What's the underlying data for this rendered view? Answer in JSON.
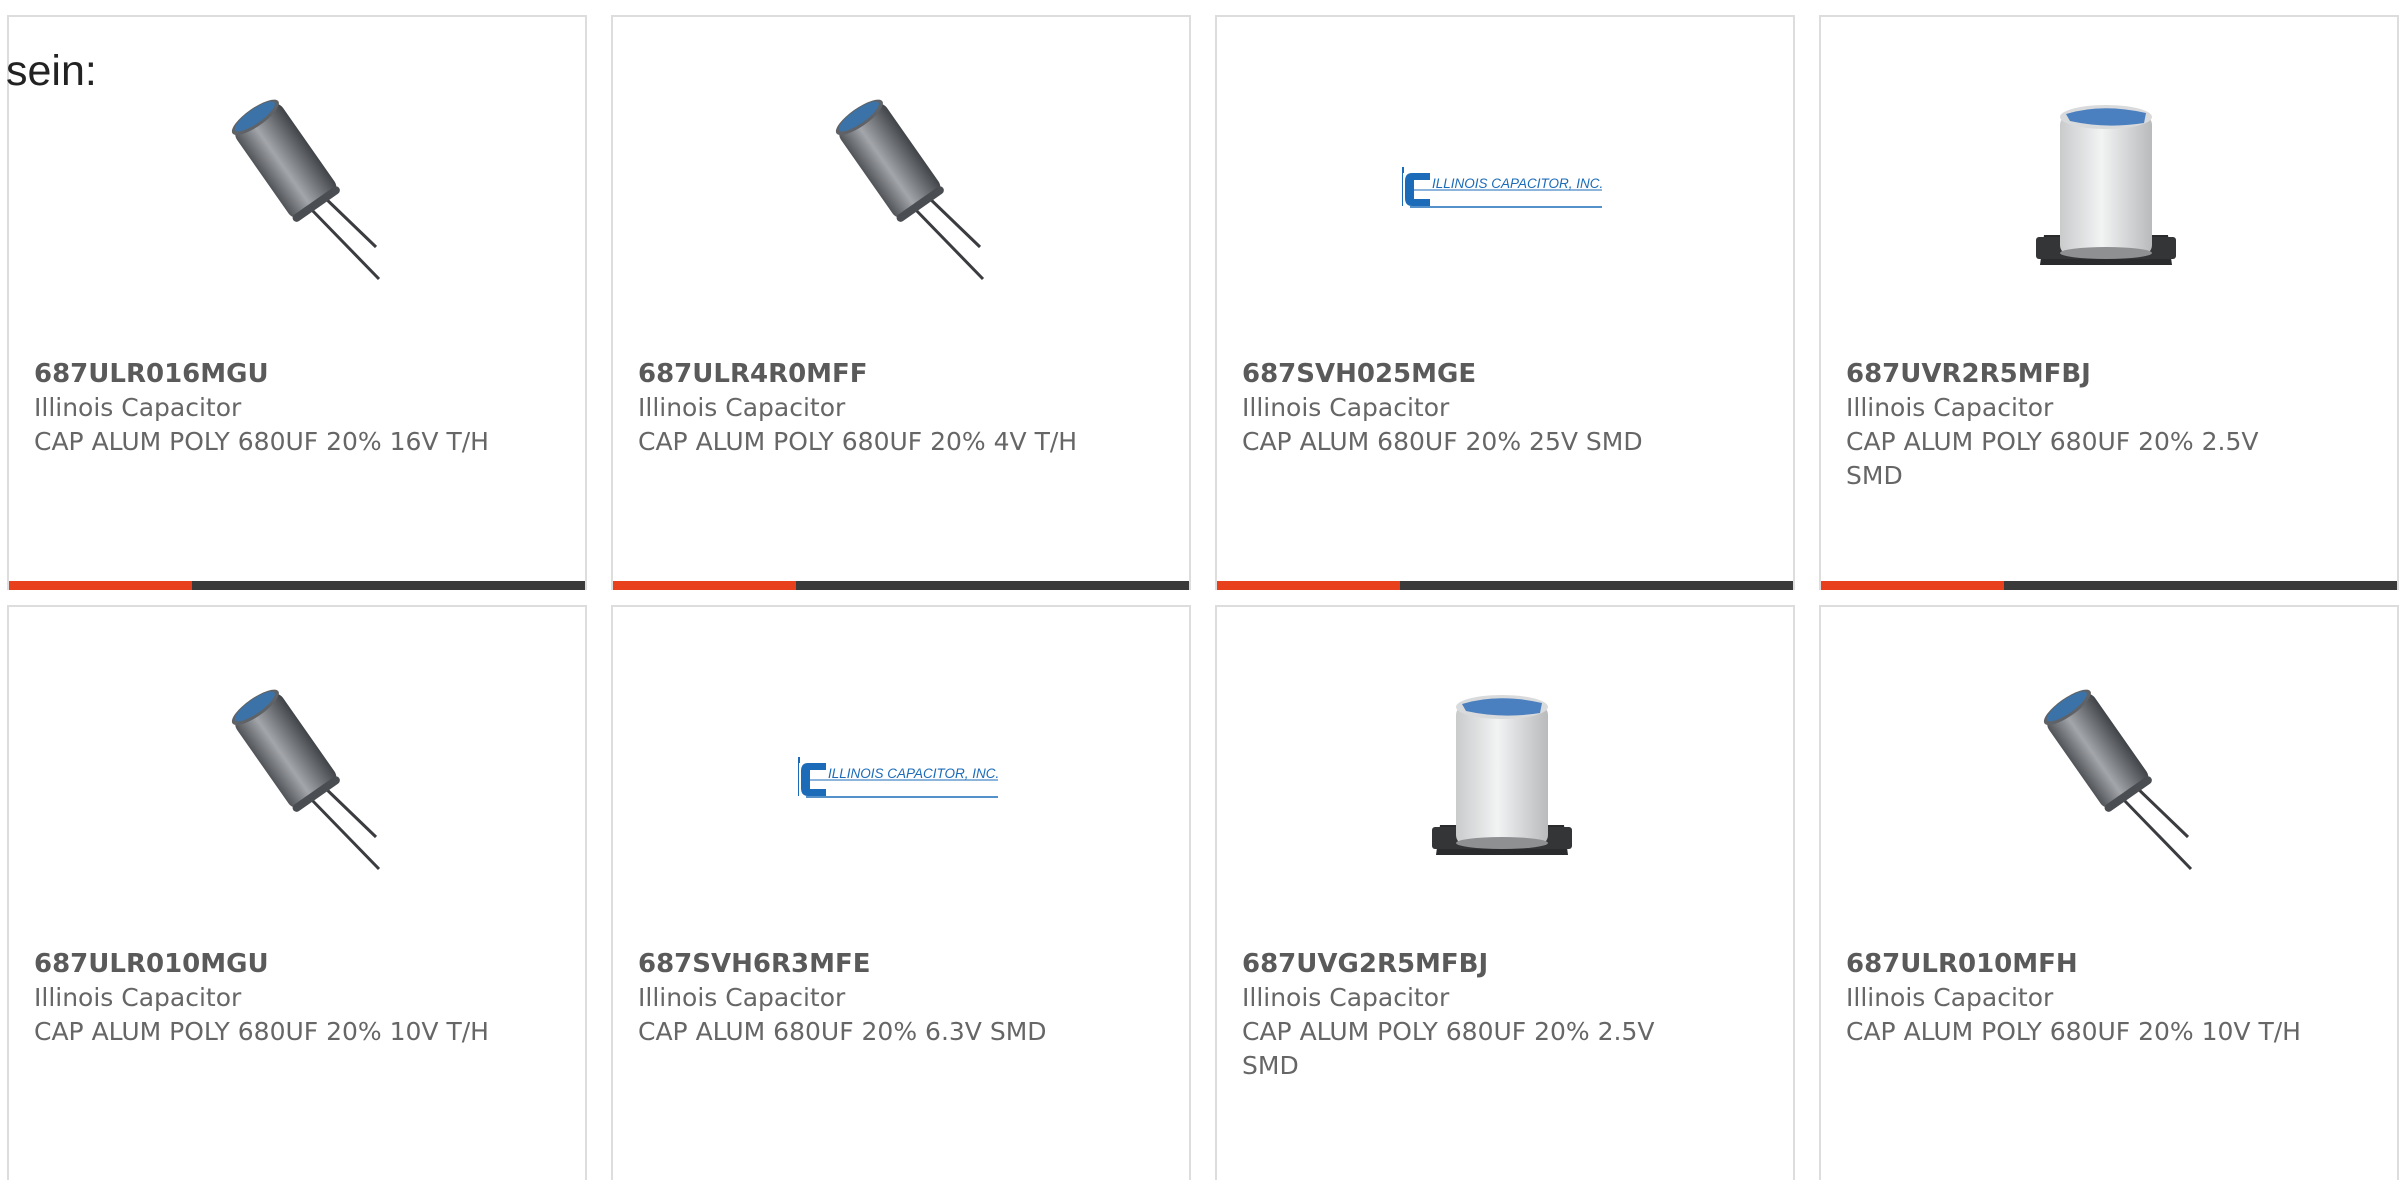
{
  "page": {
    "prefix_text": "sein:"
  },
  "colors": {
    "accent": "#e8401c",
    "bar": "#3a3a3a",
    "border": "#dddddd",
    "text": "#666666",
    "logo_blue": "#1b6bb8"
  },
  "products": [
    {
      "part_number": "687ULR016MGU",
      "manufacturer": "Illinois Capacitor",
      "description": "CAP ALUM POLY 680UF 20% 16V T/H",
      "image": "radial-capacitor-icon"
    },
    {
      "part_number": "687ULR4R0MFF",
      "manufacturer": "Illinois Capacitor",
      "description": "CAP ALUM POLY 680UF 20% 4V T/H",
      "image": "radial-capacitor-icon"
    },
    {
      "part_number": "687SVH025MGE",
      "manufacturer": "Illinois Capacitor",
      "description": "CAP ALUM 680UF 20% 25V SMD",
      "image": "illinois-capacitor-logo",
      "logo_text": "ILLINOIS CAPACITOR, INC."
    },
    {
      "part_number": "687UVR2R5MFBJ",
      "manufacturer": "Illinois Capacitor",
      "description": "CAP ALUM POLY 680UF 20% 2.5V SMD",
      "image": "smd-capacitor-icon"
    },
    {
      "part_number": "687ULR010MGU",
      "manufacturer": "Illinois Capacitor",
      "description": "CAP ALUM POLY 680UF 20% 10V T/H",
      "image": "radial-capacitor-icon"
    },
    {
      "part_number": "687SVH6R3MFE",
      "manufacturer": "Illinois Capacitor",
      "description": "CAP ALUM 680UF 20% 6.3V SMD",
      "image": "illinois-capacitor-logo",
      "logo_text": "ILLINOIS CAPACITOR, INC."
    },
    {
      "part_number": "687UVG2R5MFBJ",
      "manufacturer": "Illinois Capacitor",
      "description": "CAP ALUM POLY 680UF 20% 2.5V SMD",
      "image": "smd-capacitor-icon"
    },
    {
      "part_number": "687ULR010MFH",
      "manufacturer": "Illinois Capacitor",
      "description": "CAP ALUM POLY 680UF 20% 10V T/H",
      "image": "radial-capacitor-icon"
    }
  ]
}
